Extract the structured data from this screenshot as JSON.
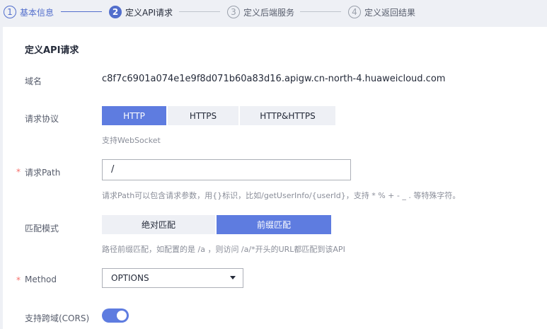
{
  "steps": [
    {
      "num": "1",
      "label": "基本信息",
      "state": "done"
    },
    {
      "num": "2",
      "label": "定义API请求",
      "state": "active"
    },
    {
      "num": "3",
      "label": "定义后端服务",
      "state": "pending"
    },
    {
      "num": "4",
      "label": "定义返回结果",
      "state": "pending"
    }
  ],
  "section": {
    "title": "定义API请求"
  },
  "domain": {
    "label": "域名",
    "value": "c8f7c6901a074e1e9f8d071b60a83d16.apigw.cn-north-4.huaweicloud.com"
  },
  "protocol": {
    "label": "请求协议",
    "options": [
      "HTTP",
      "HTTPS",
      "HTTP&HTTPS"
    ],
    "selected": "HTTP",
    "hint": "支持WebSocket"
  },
  "path": {
    "required_mark": "*",
    "label": "请求Path",
    "value": "/",
    "hint": "请求Path可以包含请求参数，用{}标识，比如/getUserInfo/{userId}，支持 * % + - _ . 等特殊字符。"
  },
  "match_mode": {
    "label": "匹配模式",
    "options": [
      "绝对匹配",
      "前缀匹配"
    ],
    "selected": "前缀匹配",
    "hint": "路径前缀匹配，如配置的是 /a ，则访问 /a/*开头的URL都匹配到该API"
  },
  "method": {
    "required_mark": "*",
    "label": "Method",
    "value": "OPTIONS",
    "icon": "chevron-down-icon"
  },
  "cors": {
    "label": "支持跨域(CORS)",
    "enabled": true
  },
  "colors": {
    "accent": "#5e7ce0",
    "required": "#f66f6a"
  }
}
